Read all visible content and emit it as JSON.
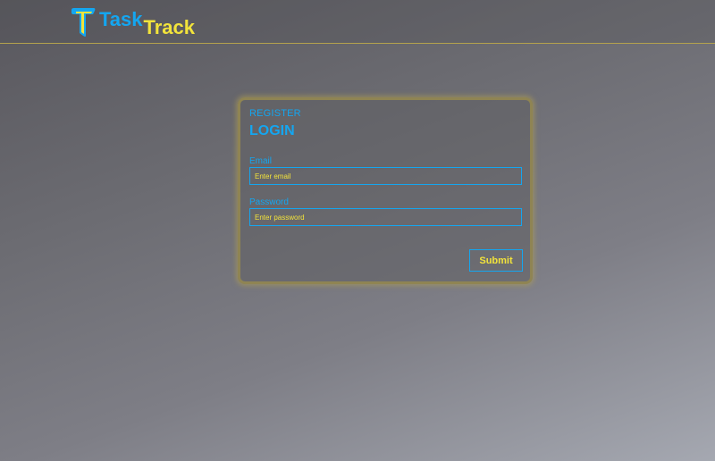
{
  "header": {
    "logo": {
      "mark_icon": "t-logo-icon",
      "word_task": "Task",
      "word_track": "Track"
    }
  },
  "form": {
    "register_link": "REGISTER",
    "title": "LOGIN",
    "email": {
      "label": "Email",
      "placeholder": "Enter email",
      "value": ""
    },
    "password": {
      "label": "Password",
      "placeholder": "Enter password",
      "value": ""
    },
    "submit_label": "Submit"
  },
  "colors": {
    "accent_blue": "#14a6f0",
    "accent_yellow": "#f2e33b",
    "header_border": "#b4a24d",
    "card_border": "#8f8453"
  }
}
